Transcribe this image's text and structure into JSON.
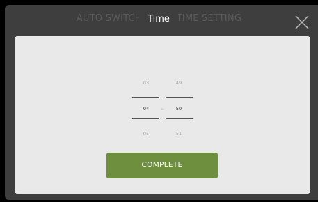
{
  "window": {
    "background_title": "AUTO SWITCH ON BY TIME SETTING",
    "dialog_title": "Time"
  },
  "close_icon": "close-x-icon",
  "picker": {
    "hours": {
      "prev": "03",
      "current": "04",
      "next": "05"
    },
    "separator": ":",
    "minutes": {
      "prev": "49",
      "current": "50",
      "next": "51"
    }
  },
  "complete_button": {
    "label": "COMPLETE"
  },
  "colors": {
    "screen_bg": "#3e3e3e",
    "panel_bg": "#e9e9e9",
    "accent_green": "#6d8f3e"
  }
}
